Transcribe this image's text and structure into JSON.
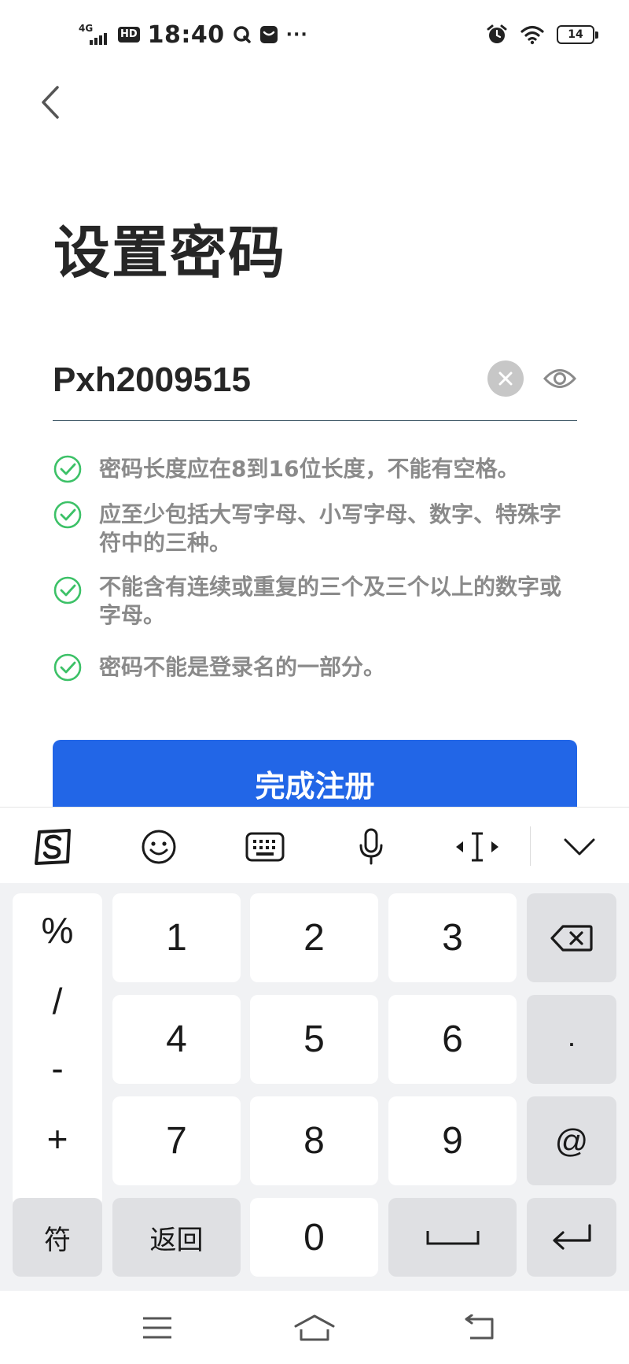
{
  "status_bar": {
    "network": "4G",
    "hd": "HD",
    "time": "18:40",
    "more": "···",
    "battery": "14"
  },
  "header": {
    "title": "设置密码"
  },
  "password": {
    "value": "Pxh2009515"
  },
  "rules": [
    {
      "text": "密码长度应在8到16位长度，不能有空格。",
      "status": "passed"
    },
    {
      "text": "应至少包括大写字母、小写字母、数字、特殊字符中的三种。",
      "status": "passed"
    },
    {
      "text": "不能含有连续或重复的三个及三个以上的数字或字母。",
      "status": "passed"
    },
    {
      "text": "密码不能是登录名的一部分。",
      "status": "passed"
    }
  ],
  "submit": {
    "label": "完成注册"
  },
  "keyboard": {
    "symbols": [
      "%",
      "/",
      "-",
      "+"
    ],
    "digits": [
      "1",
      "2",
      "3",
      "4",
      "5",
      "6",
      "7",
      "8",
      "9",
      "0"
    ],
    "dot": ".",
    "at": "@",
    "fu": "符",
    "back": "返回"
  },
  "colors": {
    "accent": "#2266e7",
    "check": "#3cc167",
    "rule_text": "#8a8a8a"
  },
  "icons": {
    "back": "chevron-left-icon",
    "clear": "clear-icon",
    "eye": "eye-icon",
    "sogou": "sogou-logo-icon",
    "emoji": "emoji-icon",
    "keyboard": "keyboard-icon",
    "mic": "microphone-icon",
    "cursor": "cursor-move-icon",
    "collapse": "chevron-down-icon",
    "backspace": "backspace-icon",
    "space": "space-icon",
    "enter": "enter-icon"
  }
}
